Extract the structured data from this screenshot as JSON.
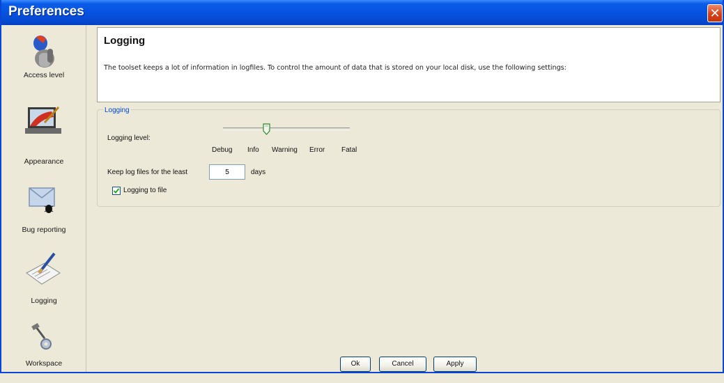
{
  "window": {
    "title": "Preferences"
  },
  "sidebar": {
    "items": [
      {
        "label": "Access level",
        "icon": "access-level-icon"
      },
      {
        "label": "Appearance",
        "icon": "appearance-icon"
      },
      {
        "label": "Bug reporting",
        "icon": "bug-reporting-icon"
      },
      {
        "label": "Logging",
        "icon": "logging-icon"
      },
      {
        "label": "Workspace",
        "icon": "workspace-icon"
      }
    ]
  },
  "header": {
    "title": "Logging",
    "description": "The toolset keeps a lot of information in logfiles. To control the amount of data that is stored on your local disk, use the following settings:"
  },
  "logging_group": {
    "legend": "Logging",
    "level_label": "Logging level:",
    "levels": [
      "Debug",
      "Info",
      "Warning",
      "Error",
      "Fatal"
    ],
    "selected_level": "Info",
    "keep_label": "Keep log files for the least",
    "keep_value": "5",
    "keep_unit": "days",
    "log_to_file_label": "Logging to file",
    "log_to_file_checked": true
  },
  "buttons": {
    "ok": "Ok",
    "cancel": "Cancel",
    "apply": "Apply"
  },
  "colors": {
    "titlebar": "#0653e0",
    "legend": "#0046d5",
    "close": "#d6401a"
  }
}
